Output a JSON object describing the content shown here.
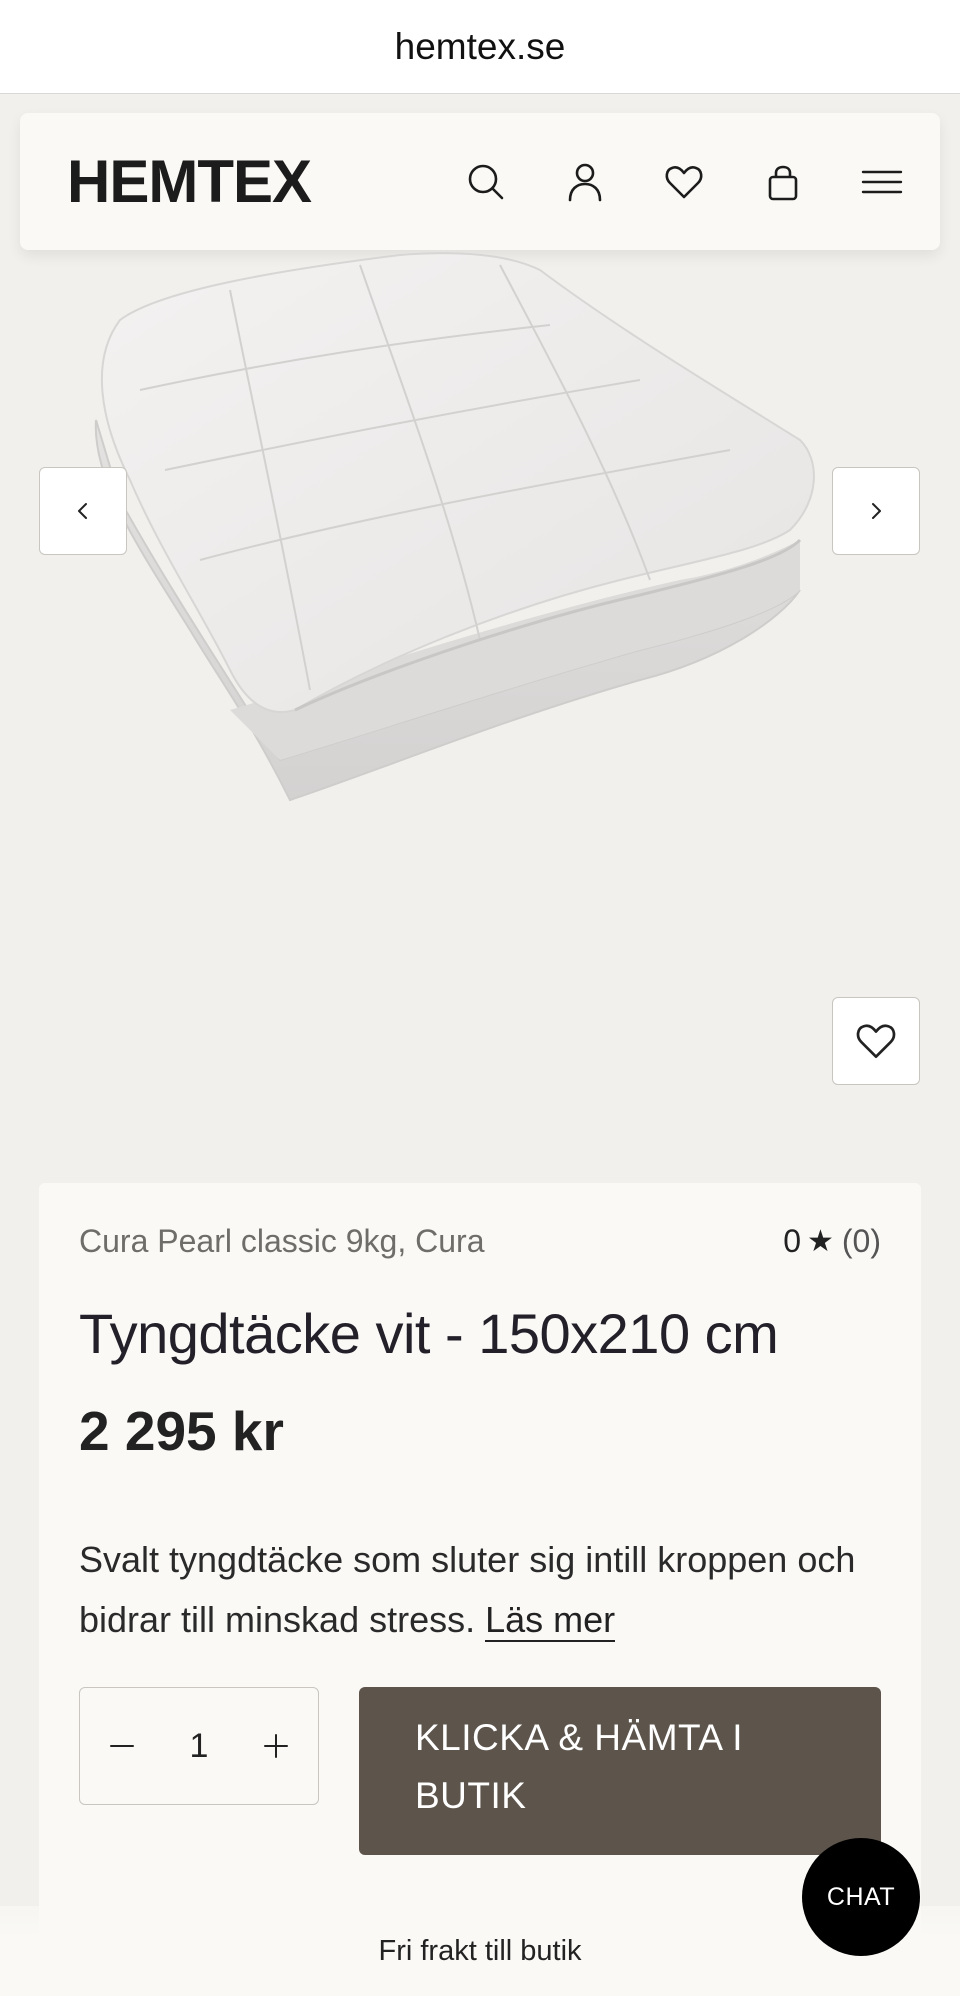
{
  "browser": {
    "url": "hemtex.se"
  },
  "header": {
    "logo": "HEMTEX",
    "icons": [
      "search-icon",
      "account-icon",
      "heart-icon",
      "bag-icon",
      "menu-icon"
    ]
  },
  "gallery": {
    "prev_icon": "chevron-left-icon",
    "next_icon": "chevron-right-icon",
    "wishlist_icon": "heart-icon"
  },
  "product": {
    "brand_line": "Cura Pearl classic 9kg, Cura",
    "rating_value": "0",
    "rating_star": "★",
    "rating_count": "(0)",
    "title": "Tyngdtäcke vit - 150x210 cm",
    "price": "2 295 kr",
    "description": "Svalt tyngdtäcke som sluter sig intill kroppen och bidrar till minskad stress.",
    "read_more": "Läs mer"
  },
  "purchase": {
    "quantity": "1",
    "cta_label": "KLICKA & HÄMTA I BUTIK"
  },
  "footer": {
    "shipping": "Fri frakt till butik",
    "chat_label": "CHAT"
  },
  "colors": {
    "page_bg": "#f1f0ec",
    "card_bg": "#faf9f6",
    "cta_bg": "#5d554c",
    "chat_bg": "#000000"
  }
}
